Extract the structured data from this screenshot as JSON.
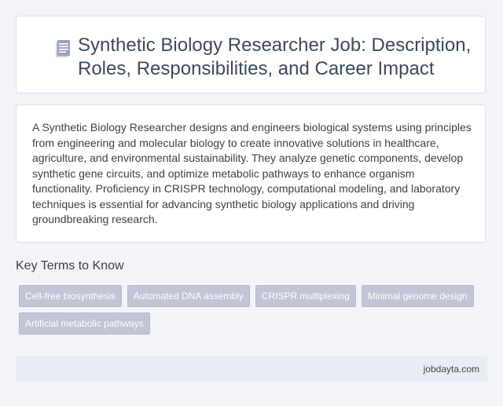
{
  "header": {
    "title": "Synthetic Biology Researcher Job: Description, Roles, Responsibilities, and Career Impact",
    "icon": "document-icon"
  },
  "description": {
    "text": "A Synthetic Biology Researcher designs and engineers biological systems using principles from engineering and molecular biology to create innovative solutions in healthcare, agriculture, and environmental sustainability. They analyze genetic components, develop synthetic gene circuits, and optimize metabolic pathways to enhance organism functionality. Proficiency in CRISPR technology, computational modeling, and laboratory techniques is essential for advancing synthetic biology applications and driving groundbreaking research."
  },
  "key_terms": {
    "heading": "Key Terms to Know",
    "items": [
      "Cell-free biosynthesis",
      "Automated DNA assembly",
      "CRISPR multiplexing",
      "Minimal genome design",
      "Artificial metabolic pathways"
    ]
  },
  "footer": {
    "site": "jobdayta.com"
  },
  "colors": {
    "background": "#f3f4f9",
    "tag_background": "#c1c5d6",
    "footer_background": "#e8ecf3",
    "title_color": "#3b4a5c"
  }
}
